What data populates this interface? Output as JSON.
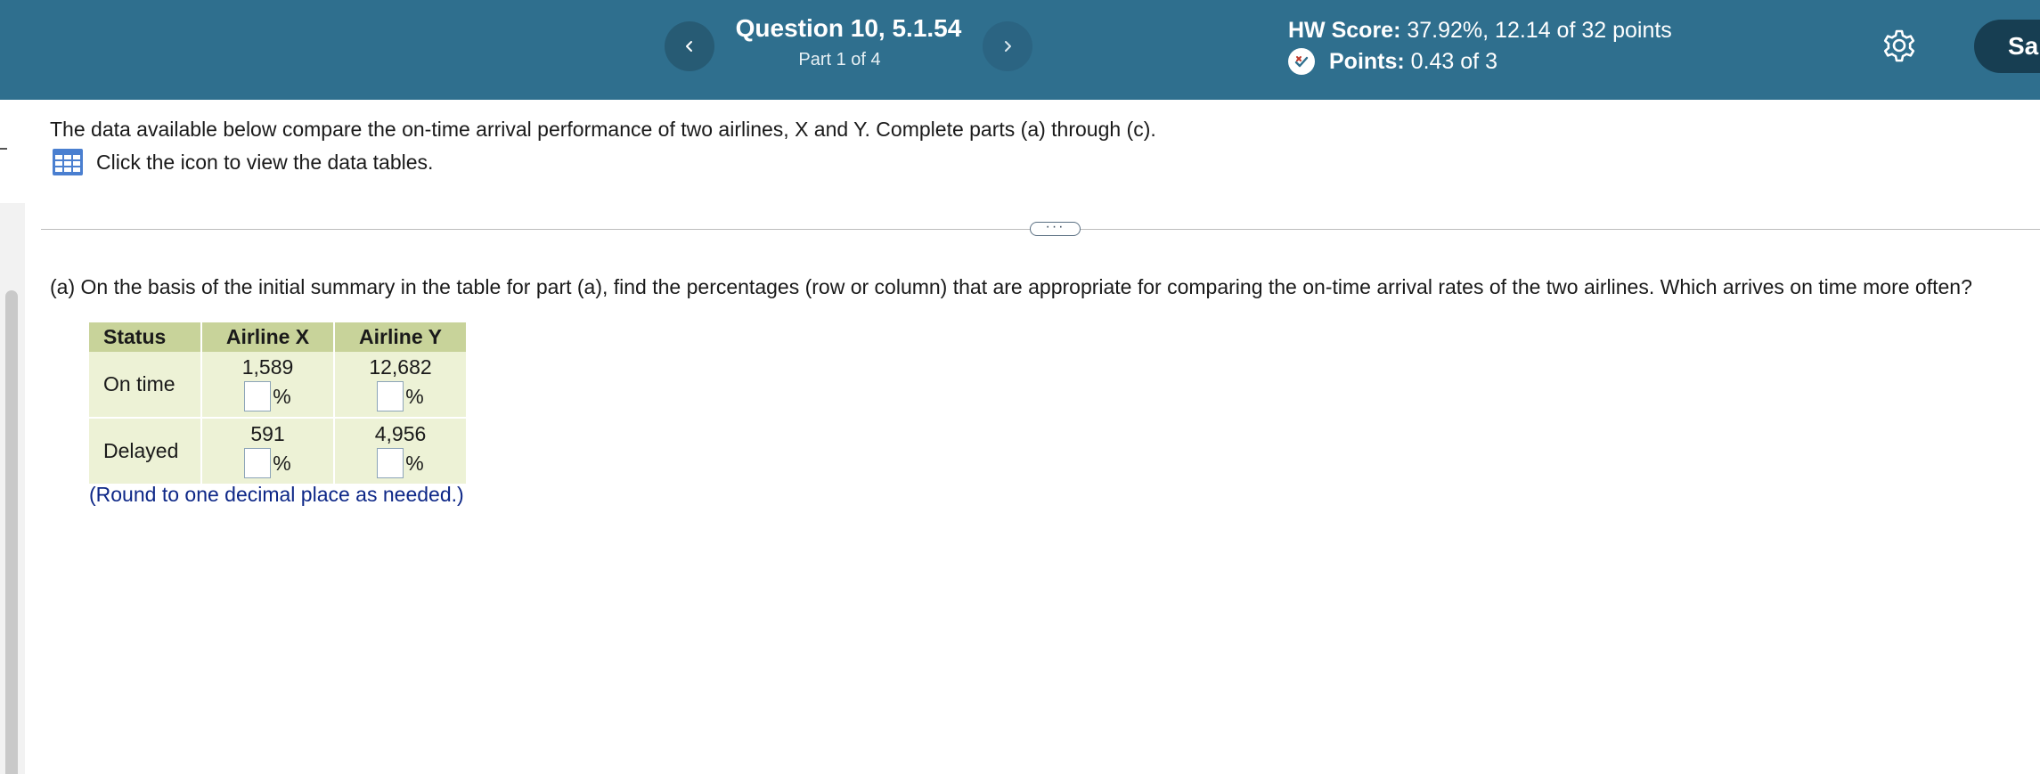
{
  "header": {
    "question_title": "Question 10, 5.1.54",
    "part": "Part 1 of 4",
    "hw_score_label": "HW Score:",
    "hw_score_value": "37.92%, 12.14 of 32 points",
    "points_label": "Points:",
    "points_value": "0.43 of 3",
    "save_label": "Sa",
    "prev_icon": "chevron-left-icon",
    "next_icon": "chevron-right-icon",
    "settings_icon": "gear-icon"
  },
  "intro": {
    "text": "The data available below compare the on-time arrival performance of two airlines, X and Y. Complete parts (a) through (c).",
    "link_text": "Click the icon to view the data tables."
  },
  "divider_handle": "···",
  "question": {
    "text": "(a) On the basis of the initial summary in the table for part (a), find the percentages (row or column) that are appropriate for comparing the on-time arrival rates of the two airlines. Which arrives on time more often?"
  },
  "table": {
    "headers": [
      "Status",
      "Airline X",
      "Airline Y"
    ],
    "rows": [
      {
        "label": "On time",
        "values": [
          "1,589",
          "12,682"
        ],
        "answers": [
          "",
          ""
        ]
      },
      {
        "label": "Delayed",
        "values": [
          "591",
          "4,956"
        ],
        "answers": [
          "",
          ""
        ]
      }
    ],
    "unit": "%"
  },
  "round_note": "(Round to one decimal place as needed.)",
  "colors": {
    "header_bg": "#2f6f8e",
    "table_header_bg": "#c8d39a",
    "table_cell_bg": "#edf2d6",
    "note_color": "#0d2787"
  }
}
